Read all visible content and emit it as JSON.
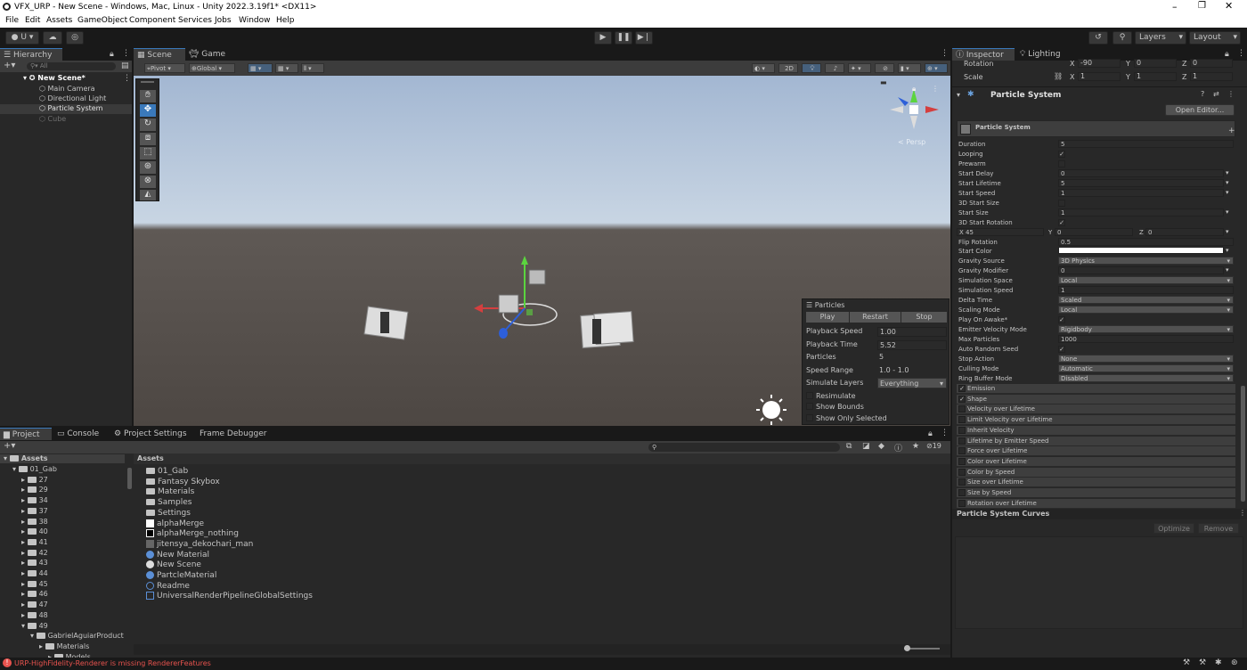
{
  "window": {
    "title": "VFX_URP - New Scene - Windows, Mac, Linux - Unity 2022.3.19f1* <DX11>"
  },
  "menu": [
    "File",
    "Edit",
    "Assets",
    "GameObject",
    "Component",
    "Services",
    "Jobs",
    "Window",
    "Help"
  ],
  "toolbar": {
    "account": "U",
    "layers": "Layers",
    "layout": "Layout"
  },
  "hierarchy": {
    "tab": "Hierarchy",
    "search_placeholder": "All",
    "scene": "New Scene*",
    "items": [
      "Main Camera",
      "Directional Light",
      "Particle System",
      "Cube"
    ]
  },
  "scene": {
    "tabs": [
      "Scene",
      "Game"
    ],
    "pivot": "Pivot",
    "global": "Global",
    "mode2d": "2D",
    "persp": "< Persp"
  },
  "particles_overlay": {
    "title": "Particles",
    "buttons": [
      "Play",
      "Restart",
      "Stop"
    ],
    "rows": [
      {
        "label": "Playback Speed",
        "value": "1.00"
      },
      {
        "label": "Playback Time",
        "value": "5.52"
      },
      {
        "label": "Particles",
        "value": "5"
      },
      {
        "label": "Speed Range",
        "value": "1.0 - 1.0"
      },
      {
        "label": "Simulate Layers",
        "value": "Everything"
      }
    ],
    "checks": [
      "Resimulate",
      "Show Bounds",
      "Show Only Selected"
    ]
  },
  "inspector": {
    "tabs": [
      "Inspector",
      "Lighting"
    ],
    "rotation": {
      "label": "Rotation",
      "x": "-90",
      "y": "0",
      "z": "0"
    },
    "scale": {
      "label": "Scale",
      "x": "1",
      "y": "1",
      "z": "1"
    },
    "component": "Particle System",
    "open_editor": "Open Editor...",
    "module": "Particle System",
    "props": [
      {
        "l": "Duration",
        "v": "5",
        "t": "f"
      },
      {
        "l": "Looping",
        "v": "✓",
        "t": "c"
      },
      {
        "l": "Prewarm",
        "v": "",
        "t": "c"
      },
      {
        "l": "Start Delay",
        "v": "0",
        "t": "d"
      },
      {
        "l": "Start Lifetime",
        "v": "5",
        "t": "d"
      },
      {
        "l": "Start Speed",
        "v": "1",
        "t": "d"
      },
      {
        "l": "3D Start Size",
        "v": "",
        "t": "c"
      },
      {
        "l": "Start Size",
        "v": "1",
        "t": "d"
      },
      {
        "l": "3D Start Rotation",
        "v": "✓",
        "t": "c"
      },
      {
        "l": "X 45",
        "v": "",
        "t": "xyz"
      },
      {
        "l": "Flip Rotation",
        "v": "0.5",
        "t": "f"
      },
      {
        "l": "Start Color",
        "v": "",
        "t": "color"
      },
      {
        "l": "Gravity Source",
        "v": "3D Physics",
        "t": "s"
      },
      {
        "l": "Gravity Modifier",
        "v": "0",
        "t": "d"
      },
      {
        "l": "Simulation Space",
        "v": "Local",
        "t": "s"
      },
      {
        "l": "Simulation Speed",
        "v": "1",
        "t": "f"
      },
      {
        "l": "Delta Time",
        "v": "Scaled",
        "t": "s"
      },
      {
        "l": "Scaling Mode",
        "v": "Local",
        "t": "s"
      },
      {
        "l": "Play On Awake*",
        "v": "✓",
        "t": "c"
      },
      {
        "l": "Emitter Velocity Mode",
        "v": "Rigidbody",
        "t": "s"
      },
      {
        "l": "Max Particles",
        "v": "1000",
        "t": "f"
      },
      {
        "l": "Auto Random Seed",
        "v": "✓",
        "t": "c"
      },
      {
        "l": "Stop Action",
        "v": "None",
        "t": "s"
      },
      {
        "l": "Culling Mode",
        "v": "Automatic",
        "t": "s"
      },
      {
        "l": "Ring Buffer Mode",
        "v": "Disabled",
        "t": "s"
      }
    ],
    "start_rotation_y": "0",
    "start_rotation_z": "0",
    "modules": [
      {
        "l": "Emission",
        "c": "✓"
      },
      {
        "l": "Shape",
        "c": "✓"
      },
      {
        "l": "Velocity over Lifetime",
        "c": ""
      },
      {
        "l": "Limit Velocity over Lifetime",
        "c": ""
      },
      {
        "l": "Inherit Velocity",
        "c": ""
      },
      {
        "l": "Lifetime by Emitter Speed",
        "c": ""
      },
      {
        "l": "Force over Lifetime",
        "c": ""
      },
      {
        "l": "Color over Lifetime",
        "c": ""
      },
      {
        "l": "Color by Speed",
        "c": ""
      },
      {
        "l": "Size over Lifetime",
        "c": ""
      },
      {
        "l": "Size by Speed",
        "c": ""
      },
      {
        "l": "Rotation over Lifetime",
        "c": ""
      }
    ],
    "curves": "Particle System Curves",
    "optimize": "Optimize",
    "remove": "Remove"
  },
  "project": {
    "tabs": [
      "Project",
      "Console",
      "Project Settings",
      "Frame Debugger"
    ],
    "hidden_count": "19",
    "tree_root": "Assets",
    "tree": [
      "01_Gab",
      "27",
      "29",
      "34",
      "37",
      "38",
      "40",
      "41",
      "42",
      "43",
      "44",
      "45",
      "46",
      "47",
      "48",
      "49",
      "GabrielAguiarProduct",
      "Materials",
      "Models"
    ],
    "breadcrumb": "Assets",
    "assets": [
      "01_Gab",
      "Fantasy Skybox",
      "Materials",
      "Samples",
      "Settings",
      "alphaMerge",
      "alphaMerge_nothing",
      "jitensya_dekochari_man",
      "New Material",
      "New Scene",
      "PartcleMaterial",
      "Readme",
      "UniversalRenderPipelineGlobalSettings"
    ]
  },
  "status": {
    "error": "URP-HighFidelity-Renderer is missing RendererFeatures"
  },
  "colors": {
    "accent": "#3a79bb",
    "error": "#e8534e",
    "panel": "#282828",
    "dark": "#191919"
  }
}
